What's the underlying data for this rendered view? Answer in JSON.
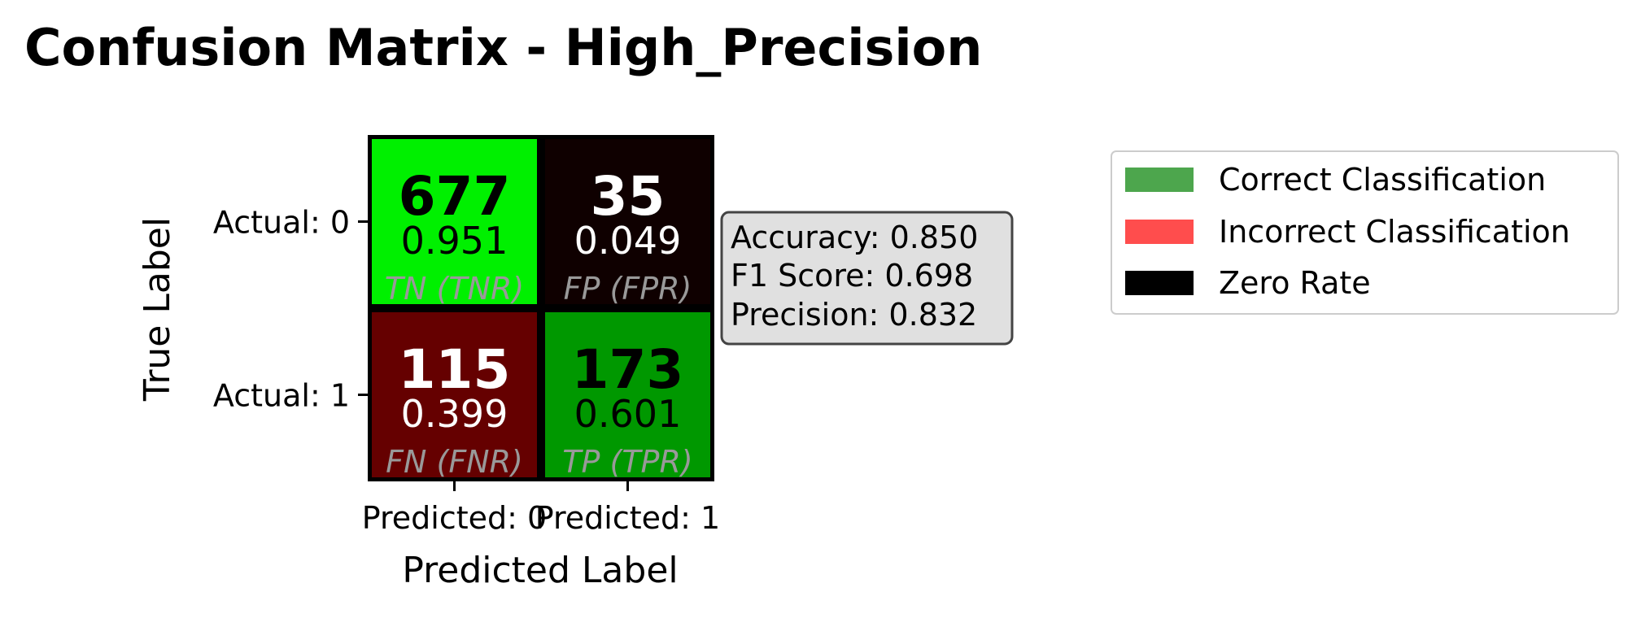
{
  "chart_data": {
    "type": "heatmap",
    "title": "Confusion Matrix - High_Precision",
    "xlabel": "Predicted Label",
    "ylabel": "True Label",
    "x_tick_labels": [
      "Predicted: 0",
      "Predicted: 1"
    ],
    "y_tick_labels": [
      "Actual: 0",
      "Actual: 1"
    ],
    "cells": [
      {
        "row": 0,
        "col": 0,
        "count": "677",
        "rate": "0.951",
        "tag": "TN (TNR)",
        "fill": "#00f000",
        "text_color": "#000000"
      },
      {
        "row": 0,
        "col": 1,
        "count": "35",
        "rate": "0.049",
        "tag": "FP (FPR)",
        "fill": "#0f0000",
        "text_color": "#ffffff"
      },
      {
        "row": 1,
        "col": 0,
        "count": "115",
        "rate": "0.399",
        "tag": "FN (FNR)",
        "fill": "#650000",
        "text_color": "#ffffff"
      },
      {
        "row": 1,
        "col": 1,
        "count": "173",
        "rate": "0.601",
        "tag": "TP (TPR)",
        "fill": "#009800",
        "text_color": "#000000"
      }
    ],
    "metrics": [
      "Accuracy: 0.850",
      "F1 Score: 0.698",
      "Precision: 0.832"
    ],
    "legend": {
      "placement": "right",
      "items": [
        {
          "label": "Correct Classification",
          "color": "#4da64d"
        },
        {
          "label": "Incorrect Classification",
          "color": "#ff4d4d"
        },
        {
          "label": "Zero Rate",
          "color": "#000000"
        }
      ]
    },
    "colors": {
      "tag_text": "#999999",
      "metrics_box_fill": "#e0e0e0",
      "metrics_box_stroke": "#444444",
      "legend_border": "#cccccc"
    }
  }
}
